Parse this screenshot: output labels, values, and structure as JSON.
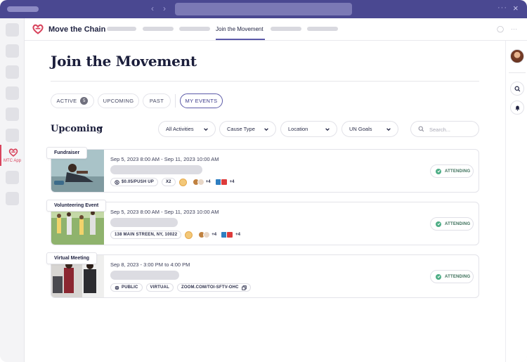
{
  "app": {
    "title": "Move the Chain",
    "sidebar_label": "MTC App",
    "brand_color": "#d8445d",
    "accent_color": "#4a4891"
  },
  "header": {
    "active_tab": "Join the Movement"
  },
  "page": {
    "title": "Join the Movement"
  },
  "tabs": [
    {
      "label": "ACTIVE",
      "count": "5"
    },
    {
      "label": "UPCOMING"
    },
    {
      "label": "PAST"
    },
    {
      "label": "MY EVENTS",
      "selected": true
    }
  ],
  "section": {
    "title": "Upcoming"
  },
  "filters": {
    "activities": "All Activities",
    "cause_type": "Cause Type",
    "location": "Location",
    "un_goals": "UN Goals",
    "search_placeholder": "Search..."
  },
  "events": [
    {
      "tag": "Fundraiser",
      "date": "Sep 5, 2023 8:00 AM - Sep 11, 2023 10:00 AM",
      "price": "$0.05/PUSH UP",
      "multiplier": "X2",
      "participants_more": "+4",
      "goals_more": "+4",
      "status": "ATTENDING"
    },
    {
      "tag": "Volunteering Event",
      "date": "Sep 5, 2023 8:00 AM - Sep 11, 2023 10:00 AM",
      "address": "138 MAIN STREEN, NY, 10022",
      "participants_more": "+4",
      "goals_more": "+4",
      "status": "ATTENDING"
    },
    {
      "tag": "Virtual Meeting",
      "date": "Sep 8, 2023 - 3:00 PM to 4:00 PM",
      "visibility": "PUBLIC",
      "mode": "VIRTUAL",
      "link": "ZOOM.COM/TOI-SFTV-OHC",
      "status": "ATTENDING"
    }
  ],
  "icons": [
    "heart-chain-logo-icon",
    "chevron-left-icon",
    "chevron-right-icon",
    "search-icon",
    "bell-icon",
    "check-icon",
    "copy-icon",
    "globe-icon",
    "dollar-icon",
    "chevron-down-icon"
  ]
}
